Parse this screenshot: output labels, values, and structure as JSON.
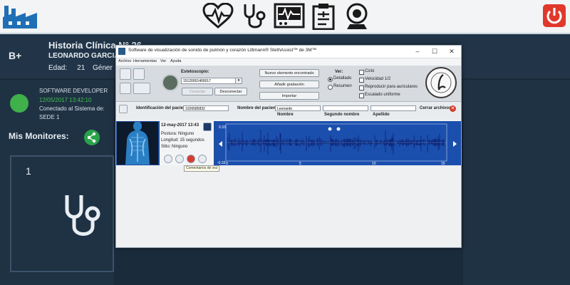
{
  "header": {
    "icons": [
      "factory-icon",
      "heart-pulse-icon",
      "stethoscope-icon",
      "monitor-icon",
      "clipboard-icon",
      "webcam-icon",
      "power-icon"
    ],
    "accent": "#1f6fb5",
    "power_color": "#e0392b"
  },
  "patient": {
    "blood_type": "B+",
    "title": "Historia Clínica N",
    "number": "26",
    "name": "LEONARDO GARCIA",
    "age_label": "Edad:",
    "age": "21",
    "gender_label": "Géner"
  },
  "user": {
    "role": "SOFTWARE DEVELOPER",
    "timestamp": "12/05/2017 13:42:10",
    "connected": "Conectado al Sistema de:",
    "site": "SEDE 1",
    "status_color": "#3fb04a"
  },
  "monitors": {
    "title": "Mis Monitores:",
    "card_number": "1"
  },
  "app": {
    "title": "Software de visualización de sonido de pulmón y corazón Littmann® StethAssist™ de 3M™",
    "menu": [
      "Archivo",
      "Herramientas",
      "Ver",
      "Ayuda"
    ],
    "stethoscope_label": "Estetoscopio:",
    "device_id": "15120001400017",
    "connect": "Conectar",
    "disconnect": "Desconectar",
    "new_recording": "Nuevo elemento encontrado",
    "add_recording": "Añadir grabación",
    "import": "Importar",
    "view_label": "Ver:",
    "view_options": [
      "Detallado",
      "Resumen"
    ],
    "checkboxes": [
      "Ciclo",
      "Velocidad 1/2",
      "Reproducir para auriculares",
      "Escalado uniforme"
    ],
    "patient_id_label": "Identificación del paciente:",
    "patient_id": "1026585832",
    "patient_name_label": "Nombre del paciente:",
    "first_name": "Leonardo",
    "name_col": "Nombre",
    "second_name_col": "Segundo nombre",
    "surname_col": "Apellido",
    "close_files": "Cerrar archivos",
    "recording": {
      "date": "12-may-2017 13:43",
      "posture_label": "Postura:",
      "posture": "Ninguno",
      "length_label": "Longitud:",
      "length": "15 segundos",
      "site_label": "Sitio:",
      "site": "Ninguno",
      "y_top": "0.33",
      "y_bottom": "-0.33",
      "x_ticks": [
        "0",
        "5",
        "10",
        "15"
      ]
    },
    "tooltip": "Comentarios de voz"
  }
}
